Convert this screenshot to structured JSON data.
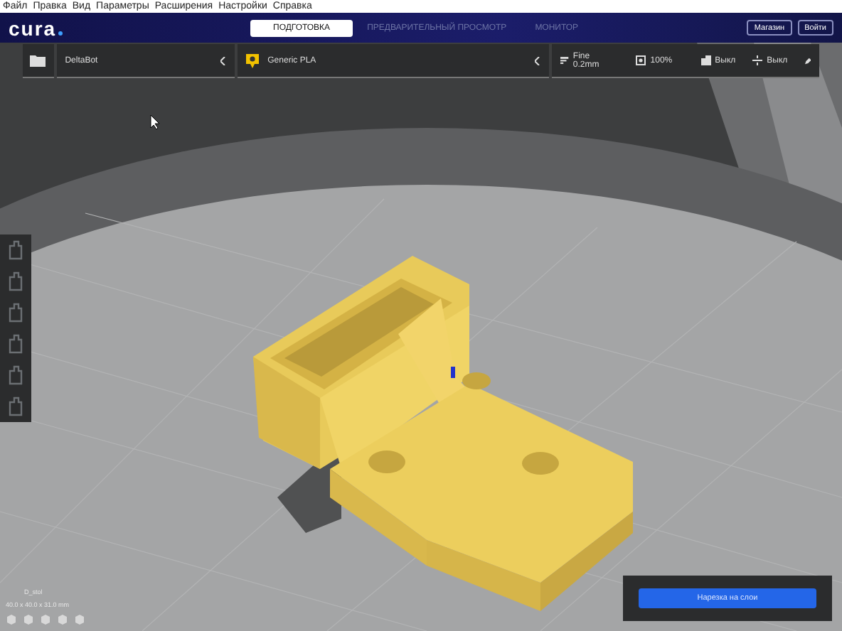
{
  "menu": [
    "Файл",
    "Правка",
    "Вид",
    "Параметры",
    "Расширения",
    "Настройки",
    "Справка"
  ],
  "header": {
    "logo": "cura",
    "tabs": [
      {
        "label": "ПОДГОТОВКА",
        "selected": true
      },
      {
        "label": "ПРЕДВАРИТЕЛЬНЫЙ ПРОСМОТР",
        "selected": false
      },
      {
        "label": "МОНИТОР",
        "selected": false
      }
    ],
    "buttons": [
      "Магазин",
      "Войти"
    ]
  },
  "toolbar": {
    "printer": "DeltaBot",
    "material": "Generic PLA",
    "profile": "Fine 0.2mm",
    "infill": "100%",
    "support": "Выкл",
    "adhesion": "Выкл"
  },
  "object": {
    "name": "D_stol",
    "dimensions": "40.0 x 40.0 x 31.0 mm"
  },
  "slice_button": "Нарезка на слои"
}
